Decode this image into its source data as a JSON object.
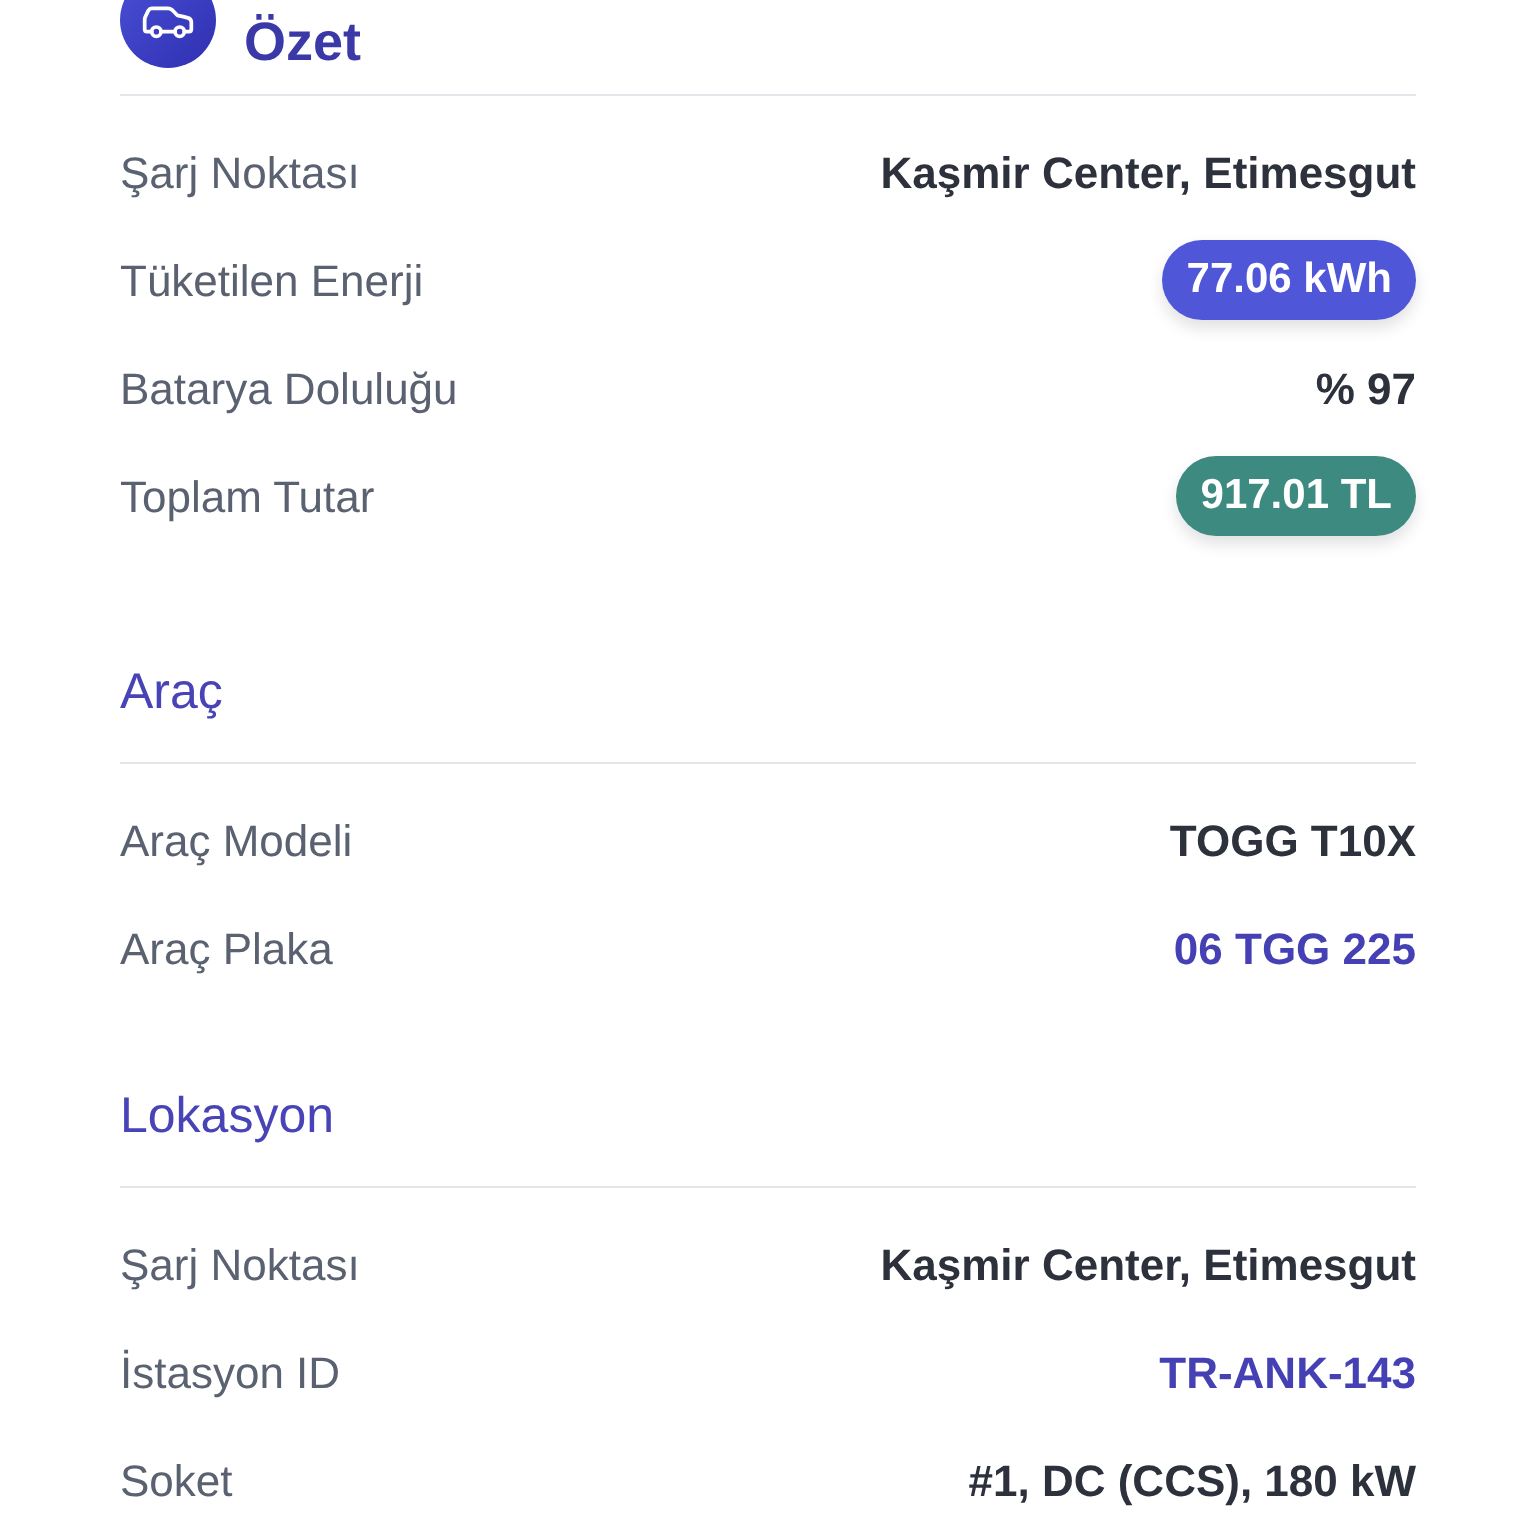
{
  "summary": {
    "title": "Özet",
    "rows": [
      {
        "label": "Şarj Noktası",
        "value": "Kaşmir Center, Etimesgut",
        "kind": "text"
      },
      {
        "label": "Tüketilen Enerji",
        "value": "77.06 kWh",
        "kind": "badge",
        "color": "#4f56d8"
      },
      {
        "label": "Batarya Doluluğu",
        "value": "% 97",
        "kind": "text"
      },
      {
        "label": "Toplam Tutar",
        "value": "917.01 TL",
        "kind": "badge",
        "color": "#3d8a80"
      }
    ]
  },
  "sections": [
    {
      "title": "Araç",
      "rows": [
        {
          "label": "Araç Modeli",
          "value": "TOGG T10X",
          "kind": "text"
        },
        {
          "label": "Araç Plaka",
          "value": "06 TGG 225",
          "kind": "accent"
        }
      ]
    },
    {
      "title": "Lokasyon",
      "rows": [
        {
          "label": "Şarj Noktası",
          "value": "Kaşmir Center, Etimesgut",
          "kind": "text"
        },
        {
          "label": "İstasyon ID",
          "value": "TR-ANK-143",
          "kind": "accent"
        },
        {
          "label": "Soket",
          "value": "#1, DC (CCS), 180 kW",
          "kind": "text"
        }
      ]
    }
  ]
}
